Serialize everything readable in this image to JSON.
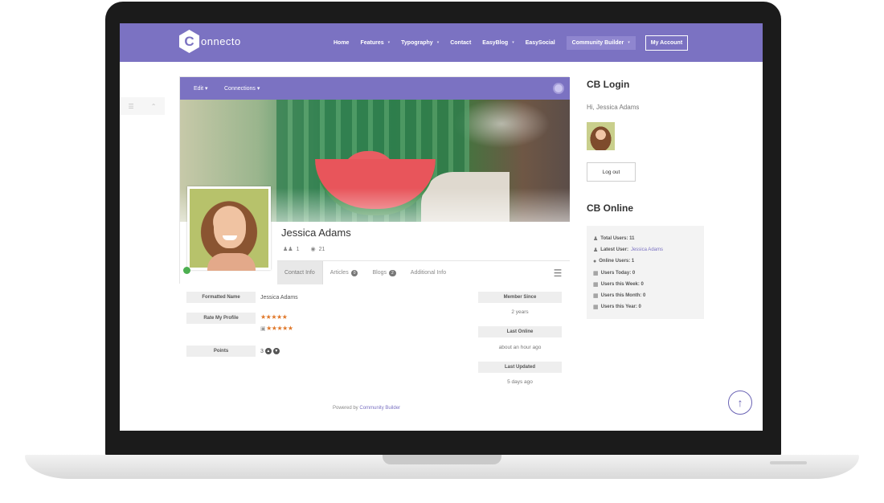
{
  "header": {
    "logo_mark": "C",
    "logo_text": "onnecto",
    "nav": [
      {
        "label": "Home",
        "caret": ""
      },
      {
        "label": "Features",
        "caret": "▾"
      },
      {
        "label": "Typography",
        "caret": "▾"
      },
      {
        "label": "Contact",
        "caret": ""
      },
      {
        "label": "EasyBlog",
        "caret": "▾"
      },
      {
        "label": "EasySocial",
        "caret": ""
      }
    ],
    "community_builder": {
      "label": "Community Builder",
      "caret": "▾"
    },
    "my_account": "My Account"
  },
  "side_tools": {
    "share_icon": "share-icon",
    "collapse_icon": "chevron-up-icon"
  },
  "profile": {
    "nav": {
      "edit": "Edit ▾",
      "connections": "Connections ▾"
    },
    "name": "Jessica Adams",
    "connections_count": "1",
    "views_count": "21",
    "tabs": {
      "contact_info": "Contact Info",
      "articles": "Articles",
      "articles_count": "0",
      "blogs": "Blogs",
      "blogs_count": "2",
      "additional_info": "Additional Info"
    },
    "fields": {
      "formatted_name_label": "Formatted Name",
      "formatted_name_value": "Jessica Adams",
      "rate_label": "Rate My Profile",
      "rating_stars": "★★★★★",
      "rating_input_stars": "★★★★★",
      "rating_value": 5,
      "points_label": "Points",
      "points_value": "3"
    },
    "meta": {
      "member_since_label": "Member Since",
      "member_since_value": "2 years",
      "last_online_label": "Last Online",
      "last_online_value": "about an hour ago",
      "last_updated_label": "Last Updated",
      "last_updated_value": "5 days ago"
    },
    "powered_prefix": "Powered by",
    "powered_link": "Community Builder"
  },
  "sidebar": {
    "login_title": "CB Login",
    "greeting": "Hi, Jessica Adams",
    "logout": "Log out",
    "online_title": "CB Online",
    "online": {
      "total_users": "Total Users: 11",
      "latest_user_label": "Latest User:",
      "latest_user_name": "Jessica Adams",
      "online_users": "Online Users: 1",
      "users_today": "Users Today: 0",
      "users_week": "Users this Week: 0",
      "users_month": "Users this Month: 0",
      "users_year": "Users this Year: 0"
    }
  },
  "colors": {
    "brand": "#7b72c2",
    "star": "#e0782a",
    "online": "#4caf50"
  }
}
